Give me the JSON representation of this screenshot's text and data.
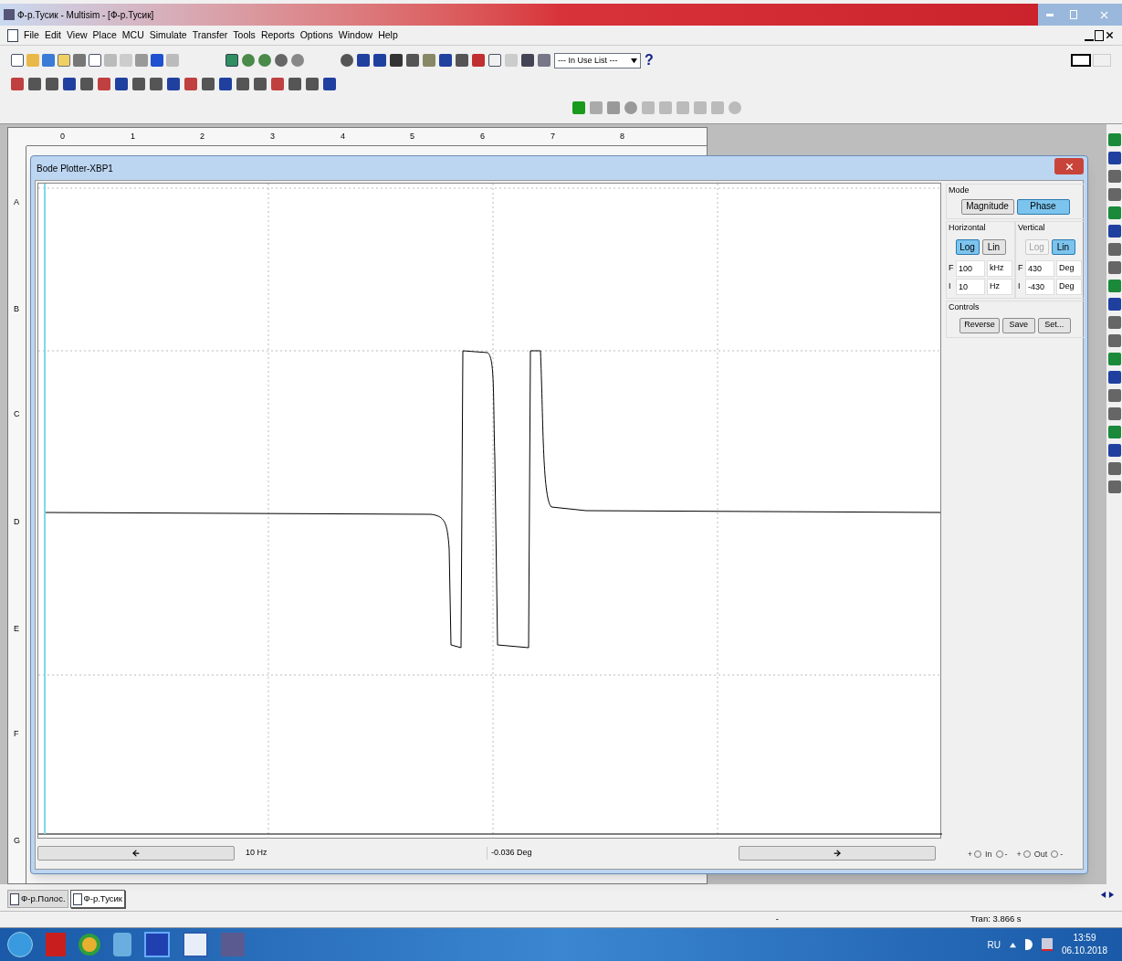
{
  "window": {
    "title": "Ф-р.Тусик - Multisim - [Ф-р.Тусик]"
  },
  "menu": [
    "File",
    "Edit",
    "View",
    "Place",
    "MCU",
    "Simulate",
    "Transfer",
    "Tools",
    "Reports",
    "Options",
    "Window",
    "Help"
  ],
  "toolbar": {
    "in_use_list": "--- In Use List ---",
    "help": "?"
  },
  "ruler": {
    "columns": [
      "0",
      "1",
      "2",
      "3",
      "4",
      "5",
      "6",
      "7",
      "8"
    ],
    "rows": [
      "A",
      "B",
      "C",
      "D",
      "E",
      "F",
      "G"
    ]
  },
  "bode_plotter": {
    "title": "Bode Plotter-XBP1",
    "readout": {
      "frequency": "10 Hz",
      "value": "-0.036 Deg"
    },
    "mode": {
      "label": "Mode",
      "buttons": [
        {
          "label": "Magnitude",
          "selected": false
        },
        {
          "label": "Phase",
          "selected": true
        }
      ]
    },
    "horizontal": {
      "label": "Horizontal",
      "scale": [
        {
          "label": "Log",
          "selected": true,
          "disabled": false
        },
        {
          "label": "Lin",
          "selected": false,
          "disabled": false
        }
      ],
      "fields": [
        {
          "prefix": "F",
          "value": "100",
          "unit": "kHz"
        },
        {
          "prefix": "I",
          "value": "10",
          "unit": "Hz"
        }
      ]
    },
    "vertical": {
      "label": "Vertical",
      "scale": [
        {
          "label": "Log",
          "selected": false,
          "disabled": true
        },
        {
          "label": "Lin",
          "selected": true,
          "disabled": false
        }
      ],
      "fields": [
        {
          "prefix": "F",
          "value": "430",
          "unit": "Deg"
        },
        {
          "prefix": "I",
          "value": "-430",
          "unit": "Deg"
        }
      ]
    },
    "controls": {
      "label": "Controls",
      "buttons": [
        "Reverse",
        "Save",
        "Set..."
      ]
    },
    "terminals": [
      {
        "plus": "+",
        "label": "In",
        "minus": "-"
      },
      {
        "plus": "+",
        "label": "Out",
        "minus": "-"
      }
    ]
  },
  "tabs": [
    {
      "label": "Ф-р.Полос.",
      "selected": false
    },
    {
      "label": "Ф-р.Тусик",
      "selected": true
    }
  ],
  "status_bar": [
    "-",
    "Tran: 3.866 s"
  ],
  "taskbar": {
    "language": "RU",
    "time": "13:59",
    "date": "06.10.2018"
  }
}
